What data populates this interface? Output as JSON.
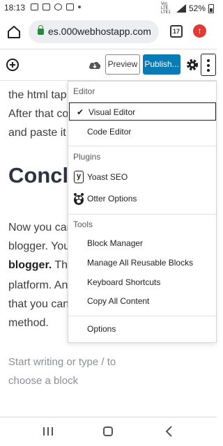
{
  "status_bar": {
    "time": "18:13",
    "network_label": "Vo) LTE LTE1",
    "battery": "52%",
    "icons": [
      "image-icon",
      "mail-icon",
      "wifi-icon",
      "voicemail-icon",
      "dot-icon"
    ]
  },
  "browser": {
    "url": "es.000webhostapp.com",
    "tab_count": "17",
    "icons": [
      "home-icon",
      "lock-icon",
      "tabs-icon",
      "update-icon"
    ],
    "accent_color": "#e53935"
  },
  "editor_toolbar": {
    "preview_label": "Preview",
    "publish_label": "Publish...",
    "publish_color": "#0a7cb5",
    "icons": [
      "add-block-icon",
      "cloud-icon",
      "gear-icon",
      "more-options-icon"
    ]
  },
  "content": {
    "lines_top": [
      "the html tap",
      "After that co",
      "and paste it"
    ],
    "heading": "Conclu",
    "lines_mid": [
      "Now you car",
      "blogger. You",
      "blogger.",
      " This",
      "platform. An",
      "that you can",
      "method."
    ],
    "placeholder": "Start writing or type / to choose a block"
  },
  "menu": {
    "editor_title": "Editor",
    "visual_editor": "Visual Editor",
    "code_editor": "Code Editor",
    "plugins_title": "Plugins",
    "yoast": "Yoast SEO",
    "otter": "Otter Options",
    "tools_title": "Tools",
    "block_manager": "Block Manager",
    "reusable_blocks": "Manage All Reusable Blocks",
    "shortcuts": "Keyboard Shortcuts",
    "copy_content": "Copy All Content",
    "options": "Options",
    "check": "✔"
  },
  "nav": {
    "icons": [
      "recents-icon",
      "home-nav-icon",
      "back-icon"
    ]
  }
}
